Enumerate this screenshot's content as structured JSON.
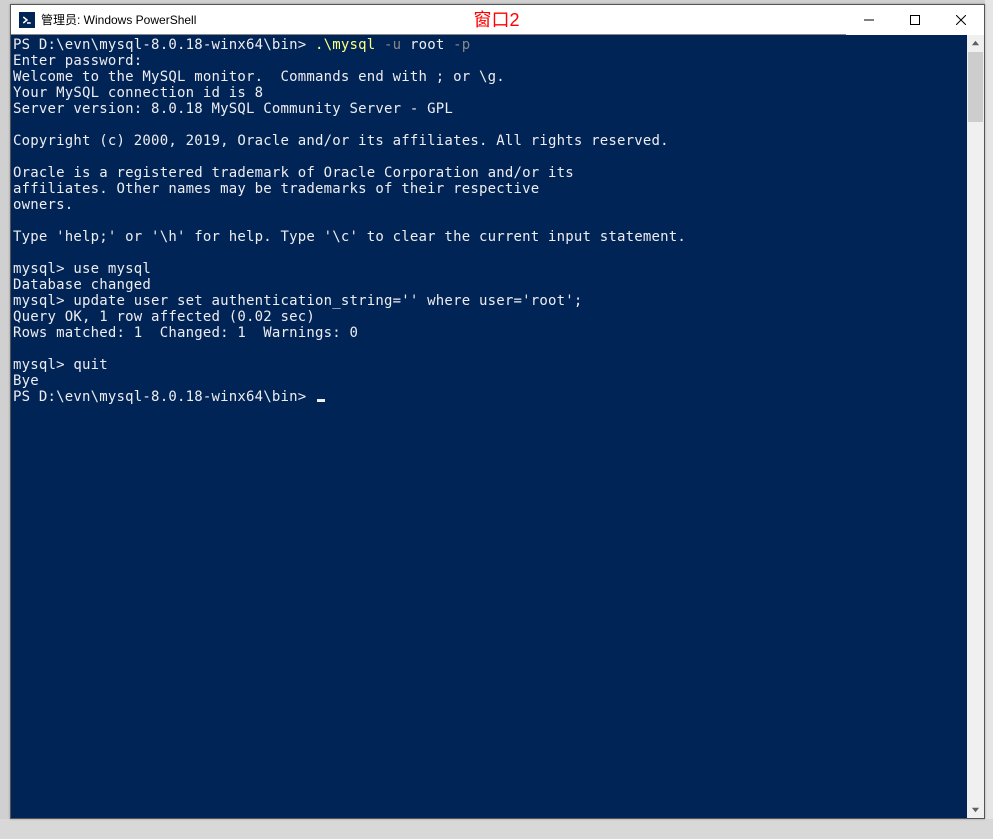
{
  "overlay": {
    "label": "窗口2"
  },
  "window": {
    "title": "管理员: Windows PowerShell",
    "icon_label": ">_"
  },
  "terminal": {
    "line01_prompt": "PS D:\\evn\\mysql-8.0.18-winx64\\bin> ",
    "line01_cmd": ".\\mysql ",
    "line01_flag1": "-u",
    "line01_arg1": " root ",
    "line01_flag2": "-p",
    "line02": "Enter password:",
    "line03": "Welcome to the MySQL monitor.  Commands end with ; or \\g.",
    "line04": "Your MySQL connection id is 8",
    "line05": "Server version: 8.0.18 MySQL Community Server - GPL",
    "line06": "",
    "line07": "Copyright (c) 2000, 2019, Oracle and/or its affiliates. All rights reserved.",
    "line08": "",
    "line09": "Oracle is a registered trademark of Oracle Corporation and/or its",
    "line10": "affiliates. Other names may be trademarks of their respective",
    "line11": "owners.",
    "line12": "",
    "line13": "Type 'help;' or '\\h' for help. Type '\\c' to clear the current input statement.",
    "line14": "",
    "line15": "mysql> use mysql",
    "line16": "Database changed",
    "line17": "mysql> update user set authentication_string='' where user='root';",
    "line18": "Query OK, 1 row affected (0.02 sec)",
    "line19": "Rows matched: 1  Changed: 1  Warnings: 0",
    "line20": "",
    "line21": "mysql> quit",
    "line22": "Bye",
    "line23_prompt": "PS D:\\evn\\mysql-8.0.18-winx64\\bin> "
  }
}
